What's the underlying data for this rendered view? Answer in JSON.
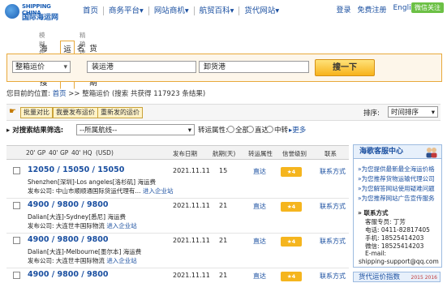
{
  "header": {
    "logo_text_en": "SHIPPING CHINA",
    "logo_text_cn": "国际海运网",
    "nav": [
      "首页",
      "商务平台",
      "网站商机",
      "航贸百科",
      "货代网站"
    ],
    "nav_suffix": "▾",
    "login": "登录",
    "register": "免费注册",
    "english": "English",
    "wechat": "微信关注"
  },
  "search": {
    "tab_hints": [
      "模糊搜索",
      "精确搜索"
    ],
    "tabs": [
      "海运一搜",
      "运价",
      "名录",
      "货代船期"
    ],
    "type_value": "整箱运价",
    "from_value": "装运港",
    "to_value": "卸货港",
    "button": "搜一下"
  },
  "breadcrumb": {
    "prefix": "您目前的位置:",
    "home": "首页",
    "sep": ">>",
    "current": "整箱运价",
    "result": "(搜索 共获得 117923 条结果)"
  },
  "toolbar": {
    "compare": "批量对比",
    "publish": "我要发布运价",
    "post": "重新发的运价",
    "sort_label": "排序:",
    "sort_value": "时间排序"
  },
  "filter": {
    "label": "对搜索结果筛选:",
    "select_value": "--所属航线--",
    "transfer_label": "转运属性:",
    "options": [
      "全部",
      "直达",
      "中转"
    ],
    "more": "更多"
  },
  "table": {
    "headers": [
      "20' GP",
      "40' GP",
      "40' HQ",
      "(USD)",
      "发布日期",
      "航期(天)",
      "转运属性",
      "信誉级别",
      "联系"
    ],
    "rows": [
      {
        "price": "12050 / 15050 / 15050",
        "route": "Shenzhen[深圳]-Los angeles[洛杉矶] 海运费",
        "publisher": "发布公司: 中山市顺顺通国际货运代理有...",
        "enter": "进入企业站",
        "date": "2021.11.11",
        "days": "15",
        "transfer": "直达",
        "contact": "联系方式",
        "rating": "4"
      },
      {
        "price": "4900 / 9800 / 9800",
        "route": "Dalian[大连]-Sydney[悉尼] 海运费",
        "publisher": "发布公司: 大连世丰国际物流",
        "enter": "进入企业站",
        "date": "2021.11.11",
        "days": "21",
        "transfer": "直达",
        "contact": "联系方式",
        "rating": "4"
      },
      {
        "price": "4900 / 9800 / 9800",
        "route": "Dalian[大连]-Melbourne[墨尔本] 海运费",
        "publisher": "发布公司: 大连世丰国际物流",
        "enter": "进入企业站",
        "date": "2021.11.11",
        "days": "21",
        "transfer": "直达",
        "contact": "联系方式",
        "rating": "4"
      },
      {
        "price": "4900 / 9800 / 9800",
        "route": "",
        "publisher": "",
        "enter": "",
        "date": "2021.11.11",
        "days": "21",
        "transfer": "直达",
        "contact": "联系方式",
        "rating": "4"
      }
    ]
  },
  "service": {
    "title": "海歌客服中心",
    "links": [
      "»为您提供最新最全海运价格",
      "»为您推荐货物运输代理公司",
      "»为您解答网站使用疑难问题",
      "»为您推荐网站广告宣传服务"
    ],
    "contact_title": "» 联系方式",
    "contact": [
      "客服专员: 丁芳",
      "电话: 0411-82817405",
      "手机: 18525414203",
      "微信: 18525414203",
      "E-mail:",
      "shipping-support@qq.com"
    ]
  },
  "index_panel": {
    "title": "货代运价指数",
    "years": "2015 2016"
  }
}
